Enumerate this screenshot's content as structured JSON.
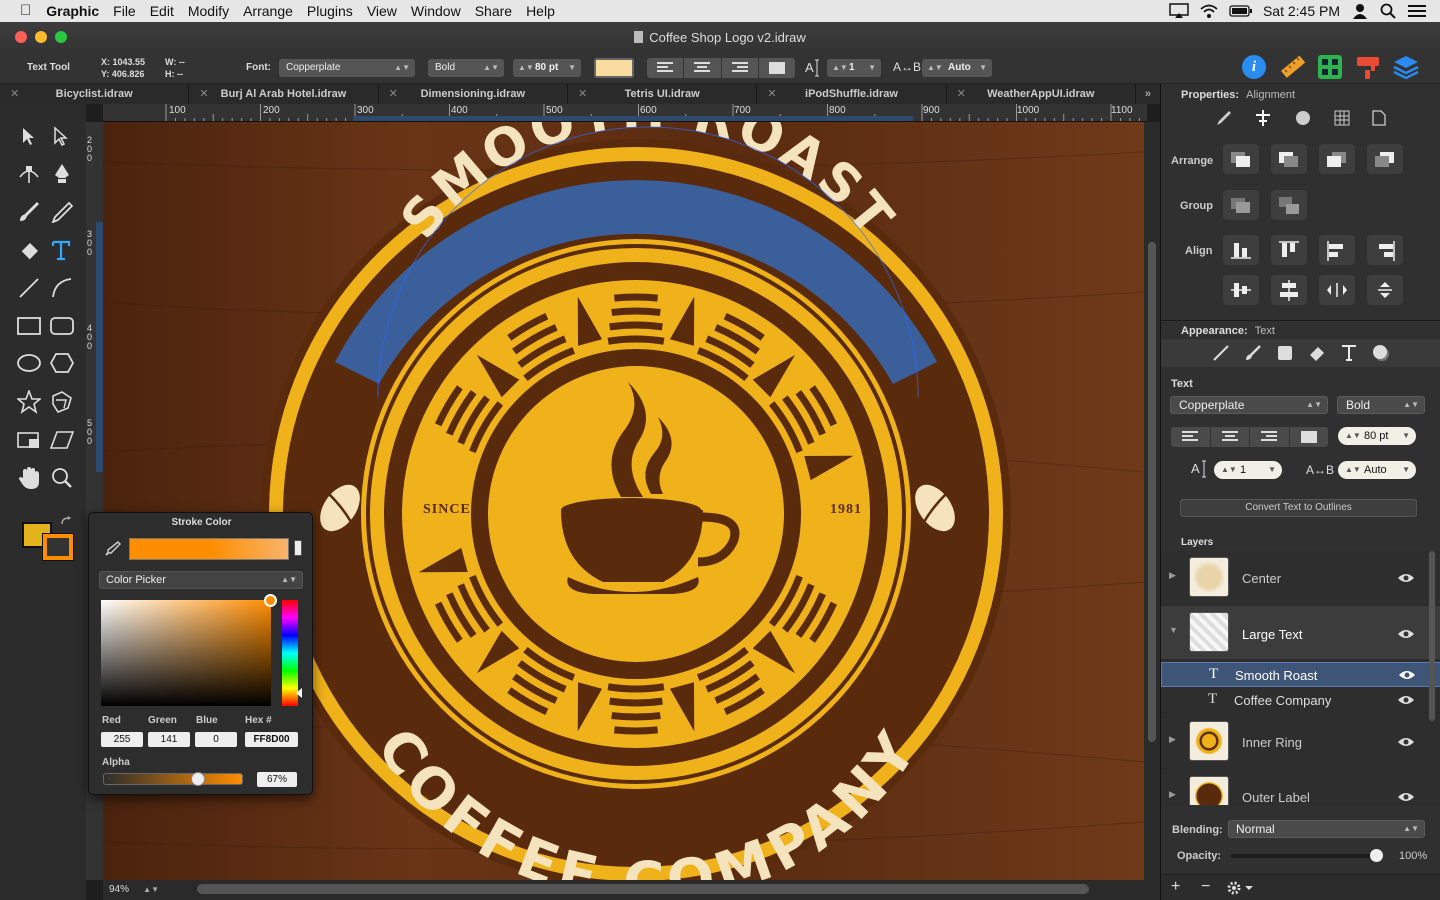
{
  "menubar": {
    "apple": "",
    "app_name": "Graphic",
    "items": [
      "File",
      "Edit",
      "Modify",
      "Arrange",
      "Plugins",
      "View",
      "Window",
      "Share",
      "Help"
    ],
    "clock": "Sat 2:45 PM"
  },
  "window": {
    "title": "Coffee Shop Logo v2.idraw"
  },
  "toolbar": {
    "tool_name": "Text Tool",
    "x_readout": "X: 1043.55",
    "y_readout": "Y: 406.826",
    "w_readout": "W: --",
    "h_readout": "H: --",
    "font_label": "Font:",
    "font_value": "Copperplate",
    "weight_value": "Bold",
    "size_value": "80 pt",
    "spacing_value": "1",
    "kern_label": "A↔B",
    "kern_value": "Auto",
    "fill_swatch_color": "#f8dca0"
  },
  "tabs": [
    "Bicyclist.idraw",
    "Burj Al Arab Hotel.idraw",
    "Dimensioning.idraw",
    "Tetris UI.idraw",
    "iPodShuffle.idraw",
    "WeatherAppUI.idraw"
  ],
  "ruler_h": [
    "100",
    "200",
    "300",
    "400",
    "500",
    "600",
    "700",
    "800",
    "900",
    "1000",
    "1100"
  ],
  "ruler_v": [
    "200",
    "300",
    "400",
    "500"
  ],
  "canvas": {
    "top_text": "SMOOTH ROAST",
    "bottom_text": "COFFEE COMPANY",
    "since": "SINCE",
    "year": "1981"
  },
  "zoom": "94%",
  "panel": {
    "properties_label": "Properties:",
    "properties_value": "Alignment",
    "arrange_label": "Arrange",
    "group_label": "Group",
    "align_label": "Align",
    "appearance_label": "Appearance:",
    "appearance_value": "Text",
    "text_label": "Text",
    "font_value": "Copperplate",
    "weight_value": "Bold",
    "size_value": "80 pt",
    "spacing_value": "1",
    "kern_label": "A↔B",
    "kern_value": "Auto",
    "convert_btn": "Convert Text to Outlines",
    "layers_label": "Layers",
    "layers": [
      {
        "name": "Center"
      },
      {
        "name": "Large Text"
      },
      {
        "name": "Smooth Roast"
      },
      {
        "name": "Coffee Company"
      },
      {
        "name": "Inner Ring"
      },
      {
        "name": "Outer Label"
      }
    ],
    "blending_label": "Blending:",
    "blending_value": "Normal",
    "opacity_label": "Opacity:",
    "opacity_value": "100%",
    "opacity_level": 1.0
  },
  "stroke": {
    "title": "Stroke Color",
    "picker_mode": "Color Picker",
    "red_label": "Red",
    "green_label": "Green",
    "blue_label": "Blue",
    "hex_label": "Hex #",
    "red": "255",
    "green": "141",
    "blue": "0",
    "hex": "FF8D00",
    "alpha_label": "Alpha",
    "alpha_value": "67%",
    "alpha_level": 0.67,
    "color": "#ff8d00"
  },
  "colors": {
    "accent_blue": "#3b5f9a",
    "logo_brown": "#5a2a0c",
    "logo_yellow": "#f0b21a",
    "logo_cream": "#f4e3bd"
  }
}
